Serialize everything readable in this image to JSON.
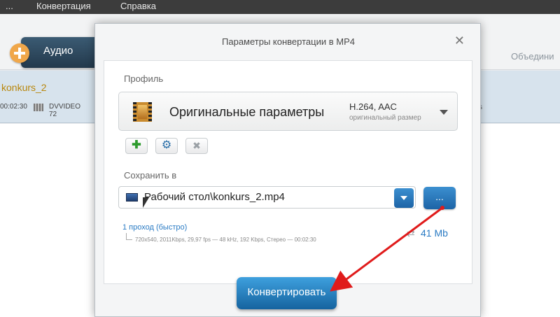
{
  "menubar": {
    "item1": "...",
    "item2": "Конвертация",
    "item3": "Справка"
  },
  "toolbar": {
    "audio_label": "Аудио",
    "merge_label": "Объедини"
  },
  "file": {
    "name": "konkurs_2",
    "duration": "00:02:30",
    "codec": "DVVIDEO 72",
    "tail": "s"
  },
  "dialog": {
    "title": "Параметры конвертации в MP4",
    "profile_label": "Профиль",
    "profile_name": "Оригинальные параметры",
    "profile_codec": "H.264, AAC",
    "profile_sub": "оригинальный размер",
    "save_label": "Сохранить в",
    "save_path": "Рабочий стол\\konkurs_2.mp4",
    "browse_label": "...",
    "pass_mode": "1 проход (быстро)",
    "specs": "720x540, 2011Kbps, 29,97 fps — 48 kHz, 192 Kbps, Стерео — 00:02:30",
    "file_size": "41 Mb",
    "convert_label": "Конвертировать"
  },
  "icons": {
    "add": "plus-icon",
    "settings": "gear-icon",
    "remove": "x-icon",
    "profile": "film-icon",
    "folder": "monitor-icon",
    "close": "close-icon"
  },
  "colors": {
    "accent": "#1d64a6",
    "annotation_arrow": "#e01b1b",
    "link": "#2a7bc4"
  }
}
